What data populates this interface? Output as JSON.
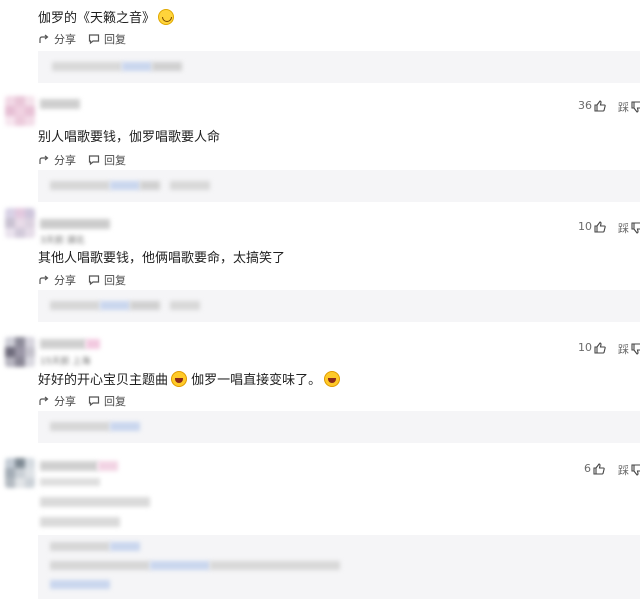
{
  "comments": [
    {
      "text": "伽罗的《天籁之音》",
      "share": "分享",
      "reply": "回复"
    },
    {
      "name": "",
      "likes": "36",
      "text": "别人唱歌要钱，伽罗唱歌要人命",
      "share": "分享",
      "reply": "回复"
    },
    {
      "name": "",
      "likes": "10",
      "meta": "3天前  湖北",
      "text": "其他人唱歌要钱，他俩唱歌要命，太搞笑了",
      "share": "分享",
      "reply": "回复"
    },
    {
      "name": "",
      "likes": "10",
      "meta": "15天前  上海",
      "text_a": "好好的开心宝贝主题曲",
      "text_b": "伽罗一唱直接变味了。",
      "share": "分享",
      "reply": "回复"
    },
    {
      "name": "",
      "likes": "6"
    }
  ],
  "dislike_glyph": "踩",
  "icons": {
    "share": "share-icon",
    "reply": "comment-icon",
    "like": "thumbs-up-icon",
    "dislike": "thumbs-down-icon"
  },
  "colors": {
    "reply_bg": "#f5f5f7",
    "blur_blue": "#c9d6ee",
    "blur_gray": "#d8d8d8"
  }
}
